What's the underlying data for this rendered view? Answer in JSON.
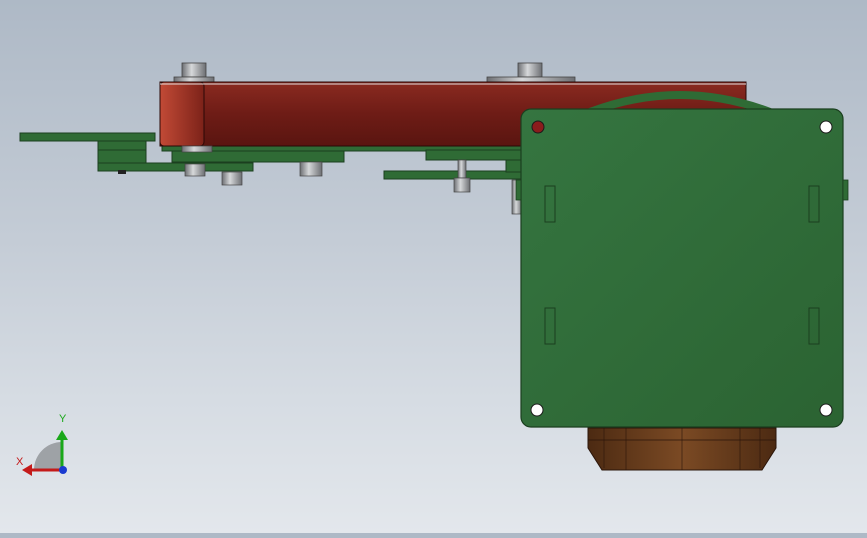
{
  "viewport": {
    "background_top": "#aeb9c6",
    "background_bottom": "#e3e7ec"
  },
  "model": {
    "arm_color": "#7a2018",
    "arm_highlight": "#b03a2a",
    "plate_color": "#2f6b35",
    "plate_edge": "#1b3f1f",
    "fastener_color": "#a8aaad",
    "motor_base_color": "#6a3c1c"
  },
  "triad": {
    "x_label": "X",
    "y_label": "Y",
    "x_color": "#c41a1a",
    "y_color": "#1aa81a",
    "z_color": "#1a3ad0"
  }
}
